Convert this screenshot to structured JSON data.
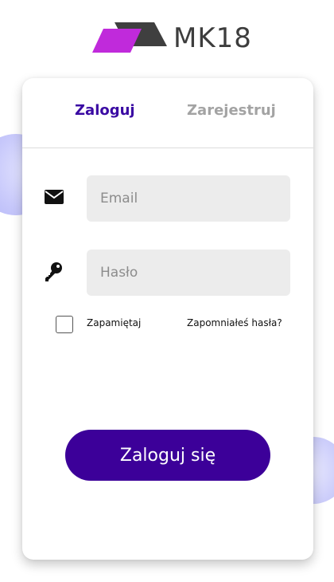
{
  "brand": {
    "name": "MK18",
    "accent_color": "#c02adb",
    "dark_color": "#3d3d3d"
  },
  "tabs": [
    {
      "label": "Zaloguj",
      "active": true
    },
    {
      "label": "Zarejestruj",
      "active": false
    }
  ],
  "form": {
    "email": {
      "icon": "envelope-icon",
      "placeholder": "Email",
      "value": ""
    },
    "password": {
      "icon": "key-icon",
      "placeholder": "Hasło",
      "value": ""
    },
    "remember": {
      "label": "Zapamiętaj",
      "checked": false
    },
    "forgot_label": "Zapomniałeś hasła?",
    "submit_label": "Zaloguj się"
  },
  "colors": {
    "primary": "#3c0099",
    "active_tab": "#3a0aa3",
    "inactive_tab": "#a3a3a3"
  }
}
